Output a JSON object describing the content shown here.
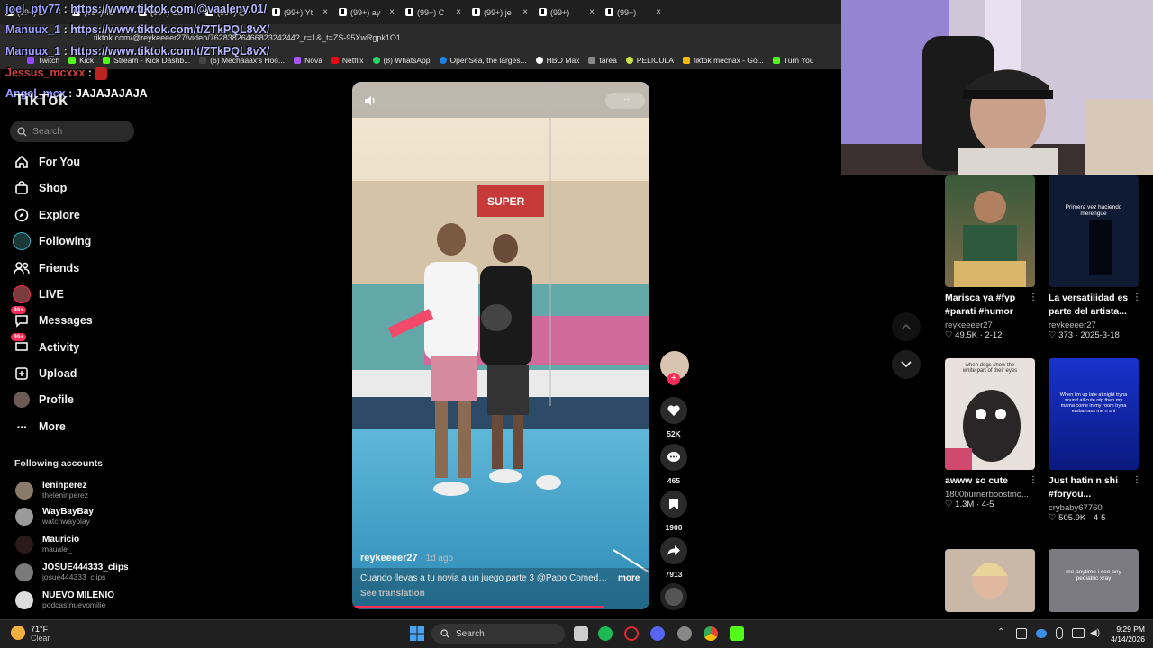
{
  "browser": {
    "tabs": [
      "(99+) L",
      "(99+) Te",
      "(99+) Ca",
      "(99+) @",
      "(99+) Yt",
      "(99+) ay",
      "(99+) C",
      "(99+) je",
      "(99+)",
      "(99+)"
    ],
    "url": "tiktok.com/@reykeeeer27/video/7628382646682324244?_r=1&_t=ZS-95XwRgpk1O1",
    "bookmarks": [
      "Twitch",
      "Kick",
      "Stream - Kick Dashb...",
      "(6) Mechaaax's Hoo...",
      "Nova",
      "Netflix",
      "(8) WhatsApp",
      "OpenSea, the larges...",
      "HBO Max",
      "tarea",
      "PELICULA",
      "tiktok mechax - Go...",
      "Turn You"
    ]
  },
  "chat": [
    {
      "user": "joel_pty77",
      "sep": " : ",
      "msg": "https://www.tiktok.com/@vaaleny.01/",
      "is_link": true
    },
    {
      "user": "Manuux_1",
      "sep": " : ",
      "msg": "https://www.tiktok.com/t/ZTkPQL8vX/",
      "is_link": true
    },
    {
      "user": "Manuux_1",
      "sep": " : ",
      "msg": "https://www.tiktok.com/t/ZTkPQL8vX/",
      "is_link": true
    },
    {
      "user": "Jessus_mcxxx",
      "sep": " : ",
      "msg": "",
      "is_link": false
    },
    {
      "user": "Angel_mcx",
      "sep": " : ",
      "msg": "JAJAJAJAJA",
      "is_link": false
    }
  ],
  "sidebar": {
    "logo": "TikTok",
    "search_placeholder": "Search",
    "nav": [
      {
        "label": "For You",
        "icon": "home-icon"
      },
      {
        "label": "Shop",
        "icon": "shop-icon"
      },
      {
        "label": "Explore",
        "icon": "compass-icon"
      },
      {
        "label": "Following",
        "icon": "avatar-icon"
      },
      {
        "label": "Friends",
        "icon": "friends-icon"
      },
      {
        "label": "LIVE",
        "icon": "live-icon"
      },
      {
        "label": "Messages",
        "icon": "messages-icon",
        "badge": "99+"
      },
      {
        "label": "Activity",
        "icon": "activity-icon",
        "badge": "99+"
      },
      {
        "label": "Upload",
        "icon": "upload-icon"
      },
      {
        "label": "Profile",
        "icon": "profile-icon"
      },
      {
        "label": "More",
        "icon": "more-icon"
      }
    ],
    "following_title": "Following accounts",
    "following": [
      {
        "name": "leninperez",
        "handle": "theleninperez"
      },
      {
        "name": "WayBayBay",
        "handle": "watchwayplay"
      },
      {
        "name": "Mauricio",
        "handle": "mauale_"
      },
      {
        "name": "JOSUE444333_clips",
        "handle": "josue444333_clips"
      },
      {
        "name": "NUEVO MILENIO",
        "handle": "podcastnuevomilie"
      }
    ]
  },
  "video": {
    "sign_text": "SUPER",
    "author": "reykeeeer27",
    "ago": " · 1d ago",
    "caption": "Cuando llevas a tu novia a un juego parte 3 @Papo Comedy ...",
    "more": "more",
    "see_translation": "See translation",
    "likes": "52K",
    "comments": "465",
    "saves": "1900",
    "shares": "7913"
  },
  "grid": [
    {
      "title": "Marisca ya #fyp #parati #humor",
      "author": "reykeeeer27",
      "likes": "49.5K",
      "date": "2-12"
    },
    {
      "title": "La versatilidad es parte del artista...",
      "author": "reykeeeer27",
      "likes": "373",
      "date": "2025-3-18",
      "overlay": "Primera vez haciendo merengue"
    },
    {
      "title": "awww so cute",
      "author": "1800burnerboostmo...",
      "likes": "1.3M",
      "date": "4-5",
      "overlay": "when dogs show the white part of their eyes"
    },
    {
      "title": "Just hatin n shi #foryou...",
      "author": "crybaby67760",
      "likes": "505.9K",
      "date": "4-5",
      "overlay": "When I'm up late at night tryna sound all cute otp then my mama come in my room tryna embarrass me n shi"
    },
    {
      "title": "",
      "author": "",
      "likes": "",
      "date": ""
    },
    {
      "title": "",
      "author": "",
      "likes": "",
      "date": "",
      "overlay": "me anytime i see any pediatric xray"
    }
  ],
  "taskbar": {
    "weather_temp": "71°F",
    "weather_desc": "Clear",
    "search": "Search",
    "time": "9:29 PM",
    "date": "4/14/2026"
  }
}
